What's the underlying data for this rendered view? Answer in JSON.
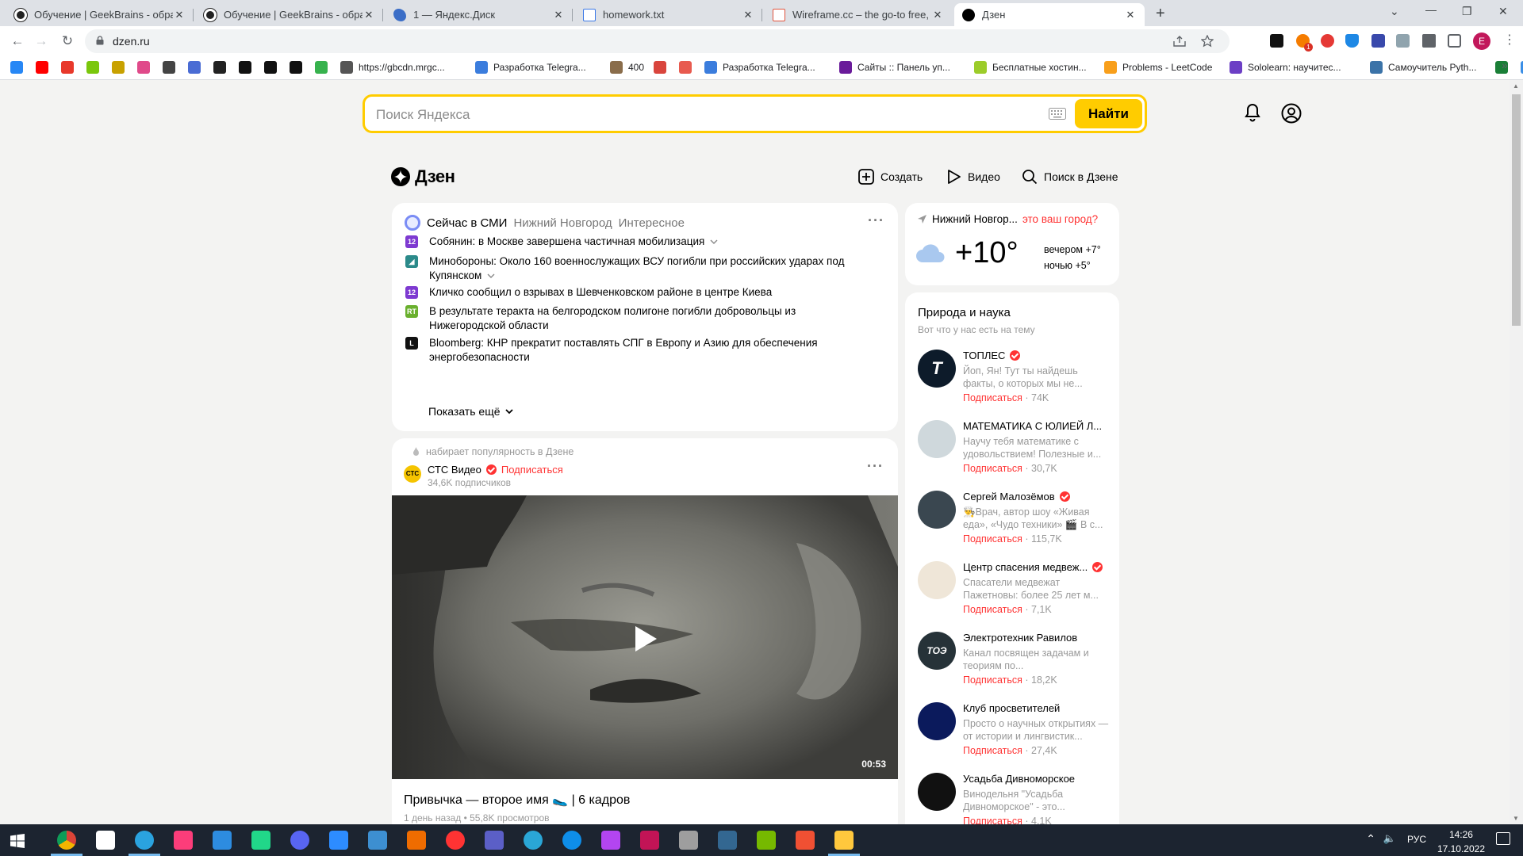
{
  "browser": {
    "tabs": [
      {
        "title": "Обучение | GeekBrains - образо",
        "icon": "geekbrains-icon"
      },
      {
        "title": "Обучение | GeekBrains - образо",
        "icon": "geekbrains-icon"
      },
      {
        "title": "1 — Яндекс.Диск",
        "icon": "yandex-disk-icon"
      },
      {
        "title": "homework.txt",
        "icon": "document-icon"
      },
      {
        "title": "Wireframe.cc – the go-to free, on",
        "icon": "wireframe-icon"
      },
      {
        "title": "Дзен",
        "icon": "dzen-icon",
        "active": true
      }
    ],
    "close_glyph": "✕",
    "new_tab_glyph": "+",
    "url": "dzen.ru",
    "profile_initial": "E",
    "extension_badge": "1",
    "bookmarks": [
      {
        "label": "",
        "icon": "vk-icon",
        "color": "#2787f5"
      },
      {
        "label": "",
        "icon": "youtube-icon",
        "color": "#ff0000"
      },
      {
        "label": "",
        "icon": "lf-icon",
        "color": "#e8392b"
      },
      {
        "label": "",
        "icon": "od-icon",
        "color": "#7ac70c"
      },
      {
        "label": "",
        "icon": "bookmark-icon",
        "color": "#c8a100"
      },
      {
        "label": "",
        "icon": "pinwheel-icon",
        "color": "#e04a8a"
      },
      {
        "label": "",
        "icon": "mail-icon",
        "color": "#444"
      },
      {
        "label": "",
        "icon": "app-icon",
        "color": "#4a6cd4"
      },
      {
        "label": "",
        "icon": "geekbrains-icon",
        "color": "#222"
      },
      {
        "label": "",
        "icon": "github-icon",
        "color": "#111"
      },
      {
        "label": "",
        "icon": "rs-icon",
        "color": "#111"
      },
      {
        "label": "",
        "icon": "circle-icon",
        "color": "#111"
      },
      {
        "label": "",
        "icon": "leaf-icon",
        "color": "#37b24d"
      },
      {
        "label": "https://gbcdn.mrgc...",
        "icon": "globe-icon",
        "color": "#555"
      },
      {
        "label": "Разработка Telegra...",
        "icon": "cloud-icon",
        "color": "#3b7ddd"
      },
      {
        "label": "400",
        "icon": "avatar-icon",
        "color": "#8a6d4b"
      },
      {
        "label": "",
        "icon": "red-app-icon",
        "color": "#d9453d"
      },
      {
        "label": "",
        "icon": "red-square-icon",
        "color": "#e85a4f"
      },
      {
        "label": "Разработка Telegra...",
        "icon": "cloud-icon",
        "color": "#3b7ddd"
      },
      {
        "label": "Сайты :: Панель уп...",
        "icon": "panel-icon",
        "color": "#6a1b9a"
      },
      {
        "label": "Бесплатные хостин...",
        "icon": "hosting-icon",
        "color": "#9ccc2a"
      },
      {
        "label": "Problems - LeetCode",
        "icon": "leetcode-icon",
        "color": "#f89f1b"
      },
      {
        "label": "Sololearn: научитес...",
        "icon": "sololearn-icon",
        "color": "#6c3fc5"
      },
      {
        "label": "Самоучитель Pyth...",
        "icon": "python-icon",
        "color": "#3b73a8"
      },
      {
        "label": "",
        "icon": "green-book-icon",
        "color": "#1a7f37"
      },
      {
        "label": "",
        "icon": "link-icon",
        "color": "#3a8ee6"
      }
    ],
    "more_bookmarks": "»"
  },
  "search": {
    "placeholder": "Поиск Яндекса",
    "button": "Найти"
  },
  "dzen": {
    "logo": "Дзен",
    "actions": {
      "create": "Создать",
      "video": "Видео",
      "search": "Поиск в Дзене"
    }
  },
  "news": {
    "title": "Сейчас в СМИ",
    "tab_region": "Нижний Новгород",
    "tab_interesting": "Интересное",
    "items": [
      {
        "src": "12",
        "src_color": "#7e3ad1",
        "text": "Собянин: в Москве завершена частичная мобилизация",
        "expand": true
      },
      {
        "src": "◢",
        "src_color": "#2b8a8a",
        "text": "Минобороны: Около 160 военнослужащих ВСУ погибли при российских ударах под Купянском",
        "expand": true
      },
      {
        "src": "12",
        "src_color": "#7e3ad1",
        "text": "Кличко сообщил о взрывах в Шевченковском районе в центре Киева",
        "expand": false
      },
      {
        "src": "RT",
        "src_color": "#6ab02e",
        "text": "В результате теракта на белгородском полигоне погибли добровольцы из Нижегородской области",
        "expand": false
      },
      {
        "src": "L",
        "src_color": "#111",
        "text": "Bloomberg: КНР прекратит поставлять СПГ в Европу и Азию для обеспечения энергобезопасности",
        "expand": false
      }
    ],
    "show_more": "Показать ещё"
  },
  "weather": {
    "city": "Нижний Новгор...",
    "question": "это ваш город?",
    "temp": "+10°",
    "evening": "вечером +7°",
    "night": "ночью +5°"
  },
  "channels": {
    "title": "Природа и наука",
    "subtitle": "Вот что у нас есть на тему",
    "subscribe": "Подписаться",
    "items": [
      {
        "name": "ТОПЛЕС",
        "verified": true,
        "desc": "Йоп, Ян! Тут ты найдешь факты, о которых мы не...",
        "count": "· 74K",
        "avatar_color": "#0d1b2a",
        "avatar_text": "T"
      },
      {
        "name": "МАТЕМАТИКА С ЮЛИЕЙ Л...",
        "verified": false,
        "desc": "Научу тебя математике с удовольствием! Полезные и...",
        "count": "· 30,7K",
        "avatar_color": "#cfd8dc",
        "avatar_text": ""
      },
      {
        "name": "Сергей Малозёмов",
        "verified": true,
        "desc": "👨‍🍳Врач, автор шоу «Живая еда», «Чудо техники» 🎬 В с...",
        "count": "· 115,7K",
        "avatar_color": "#3a4750",
        "avatar_text": ""
      },
      {
        "name": "Центр спасения медвеж...",
        "verified": true,
        "desc": "Спасатели медвежат Пажетновы: более 25 лет м...",
        "count": "· 7,1K",
        "avatar_color": "#efe6d8",
        "avatar_text": ""
      },
      {
        "name": "Электротехник Равилов",
        "verified": false,
        "desc": "Канал посвящен задачам и теориям по...",
        "count": "· 18,2K",
        "avatar_color": "#263238",
        "avatar_text": "ТОЭ"
      },
      {
        "name": "Клуб просветителей",
        "verified": false,
        "desc": "Просто о научных открытиях — от истории и лингвистик...",
        "count": "· 27,4K",
        "avatar_color": "#0b1a5c",
        "avatar_text": ""
      },
      {
        "name": "Усадьба Дивноморское",
        "verified": false,
        "desc": "Винодельня \"Усадьба Дивноморское\" - это...",
        "count": "· 4,1K",
        "avatar_color": "#111",
        "avatar_text": ""
      }
    ]
  },
  "post": {
    "trending": "набирает популярность в Дзене",
    "channel": "СТС Видео",
    "avatar_text": "СТС",
    "subscribe": "Подписаться",
    "subscribers": "34,6K подписчиков",
    "duration": "00:53",
    "title": "Привычка — второе имя 🥿 | 6 кадров",
    "meta": "1 день назад • 55,8K просмотров"
  },
  "taskbar": {
    "apps": [
      {
        "name": "chrome-taskbar",
        "color": "#f2b100",
        "active": true
      },
      {
        "name": "notion-taskbar",
        "color": "#fff"
      },
      {
        "name": "telegram-taskbar",
        "color": "#2aa3df",
        "active": true
      },
      {
        "name": "intellij-taskbar",
        "color": "#fc3d7a"
      },
      {
        "name": "vscode-taskbar",
        "color": "#2d8ce0"
      },
      {
        "name": "pycharm-taskbar",
        "color": "#21d789"
      },
      {
        "name": "discord-taskbar",
        "color": "#5865f2"
      },
      {
        "name": "zoom-taskbar",
        "color": "#2d8cff"
      },
      {
        "name": "snip-taskbar",
        "color": "#3d8fd1"
      },
      {
        "name": "paint-taskbar",
        "color": "#ef6c00"
      },
      {
        "name": "yandex-taskbar",
        "color": "#f33"
      },
      {
        "name": "teams-taskbar",
        "color": "#5b5fc7"
      },
      {
        "name": "timer-taskbar",
        "color": "#2aa6d6"
      },
      {
        "name": "teamviewer-taskbar",
        "color": "#0e8ee9"
      },
      {
        "name": "phpstorm-taskbar",
        "color": "#b345f1"
      },
      {
        "name": "rider-taskbar",
        "color": "#c21456"
      },
      {
        "name": "database-taskbar",
        "color": "#9e9e9e"
      },
      {
        "name": "postgres-taskbar",
        "color": "#336791"
      },
      {
        "name": "nvidia-taskbar",
        "color": "#76b900"
      },
      {
        "name": "git-taskbar",
        "color": "#f05033"
      },
      {
        "name": "explorer-taskbar",
        "color": "#ffc83d",
        "active": true
      }
    ],
    "up_arrow": "⌃",
    "lang": "РУС",
    "time": "14:26",
    "date": "17.10.2022"
  }
}
